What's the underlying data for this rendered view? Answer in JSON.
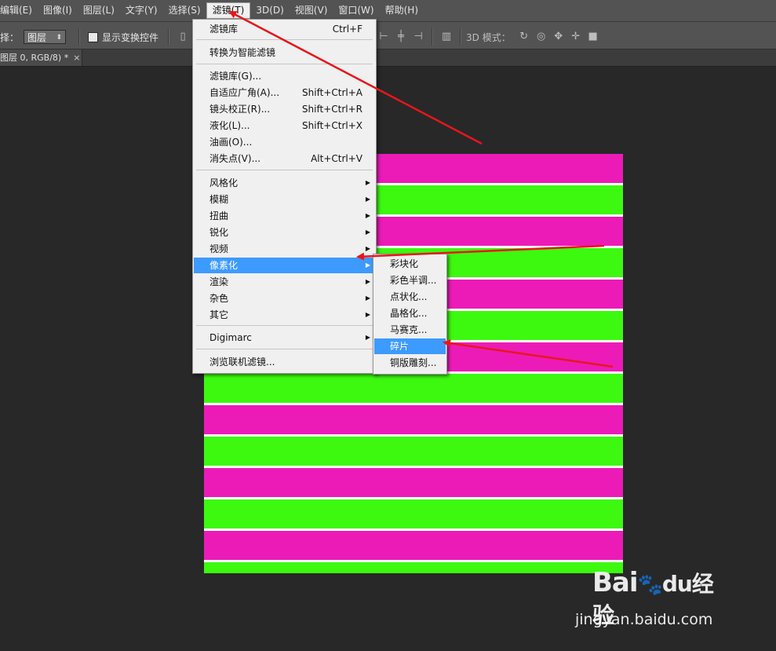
{
  "menubar": {
    "items": [
      {
        "label": "编辑(E)"
      },
      {
        "label": "图像(I)"
      },
      {
        "label": "图层(L)"
      },
      {
        "label": "文字(Y)"
      },
      {
        "label": "选择(S)"
      },
      {
        "label": "滤镜(T)"
      },
      {
        "label": "3D(D)"
      },
      {
        "label": "视图(V)"
      },
      {
        "label": "窗口(W)"
      },
      {
        "label": "帮助(H)"
      }
    ]
  },
  "options": {
    "select_label": "择：",
    "select_value": "图层",
    "show_transform_label": "显示变换控件",
    "mode_3d_label": "3D 模式："
  },
  "document": {
    "tab_title": "图层 0, RGB/8) *",
    "close_glyph": "×"
  },
  "filter_menu": {
    "items": [
      {
        "label": "滤镜库",
        "shortcut": "Ctrl+F"
      },
      {
        "label": "转换为智能滤镜",
        "shortcut": ""
      },
      {
        "label": "滤镜库(G)...",
        "shortcut": ""
      },
      {
        "label": "自适应广角(A)...",
        "shortcut": "Shift+Ctrl+A"
      },
      {
        "label": "镜头校正(R)...",
        "shortcut": "Shift+Ctrl+R"
      },
      {
        "label": "液化(L)...",
        "shortcut": "Shift+Ctrl+X"
      },
      {
        "label": "油画(O)...",
        "shortcut": ""
      },
      {
        "label": "消失点(V)...",
        "shortcut": "Alt+Ctrl+V"
      },
      {
        "label": "风格化",
        "shortcut": ""
      },
      {
        "label": "模糊",
        "shortcut": ""
      },
      {
        "label": "扭曲",
        "shortcut": ""
      },
      {
        "label": "锐化",
        "shortcut": ""
      },
      {
        "label": "视频",
        "shortcut": ""
      },
      {
        "label": "像素化",
        "shortcut": ""
      },
      {
        "label": "渲染",
        "shortcut": ""
      },
      {
        "label": "杂色",
        "shortcut": ""
      },
      {
        "label": "其它",
        "shortcut": ""
      },
      {
        "label": "Digimarc",
        "shortcut": ""
      },
      {
        "label": "浏览联机滤镜...",
        "shortcut": ""
      }
    ],
    "submenu_arrow": "▶"
  },
  "pixelate_submenu": {
    "items": [
      {
        "label": "彩块化"
      },
      {
        "label": "彩色半调..."
      },
      {
        "label": "点状化..."
      },
      {
        "label": "晶格化..."
      },
      {
        "label": "马赛克..."
      },
      {
        "label": "碎片"
      },
      {
        "label": "铜版雕刻..."
      }
    ]
  },
  "watermark": {
    "brand": "Bai",
    "brand_du": "du",
    "brand_cn": "经验",
    "url": "jingyan.baidu.com"
  },
  "colors": {
    "magenta": "#ec1bb8",
    "green": "#3cf90f",
    "highlight": "#3d9aff",
    "arrow": "#e8161c"
  }
}
